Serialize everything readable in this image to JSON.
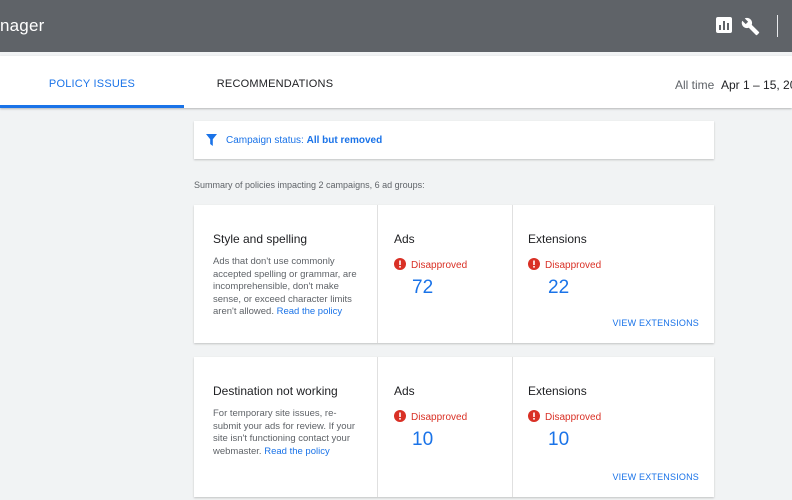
{
  "header": {
    "app_title": "nager",
    "icons": [
      "bar-chart-icon",
      "wrench-icon"
    ]
  },
  "tabs": [
    {
      "label": "POLICY ISSUES",
      "active": true
    },
    {
      "label": "RECOMMENDATIONS",
      "active": false
    }
  ],
  "date_range": {
    "label": "All time",
    "value": "Apr 1 – 15, 20"
  },
  "filter": {
    "label": "Campaign status:",
    "value": "All but removed",
    "icon": "filter-icon"
  },
  "summary": "Summary of policies impacting 2 campaigns, 6 ad groups:",
  "policies": [
    {
      "title": "Style and spelling",
      "description": "Ads that don't use commonly accepted spelling or grammar, are incomprehensible, don't make sense, or exceed character limits aren't allowed.",
      "link": "Read the policy",
      "ads": {
        "heading": "Ads",
        "status": "Disapproved",
        "count": "72"
      },
      "extensions": {
        "heading": "Extensions",
        "status": "Disapproved",
        "count": "22",
        "action": "VIEW EXTENSIONS"
      }
    },
    {
      "title": "Destination not working",
      "description": "For temporary site issues, re-submit your ads for review. If your site isn't functioning contact your webmaster.",
      "link": "Read the policy",
      "ads": {
        "heading": "Ads",
        "status": "Disapproved",
        "count": "10"
      },
      "extensions": {
        "heading": "Extensions",
        "status": "Disapproved",
        "count": "10",
        "action": "VIEW EXTENSIONS"
      }
    }
  ],
  "colors": {
    "accent": "#1a73e8",
    "error": "#d93025",
    "topbar": "#5f6368"
  }
}
